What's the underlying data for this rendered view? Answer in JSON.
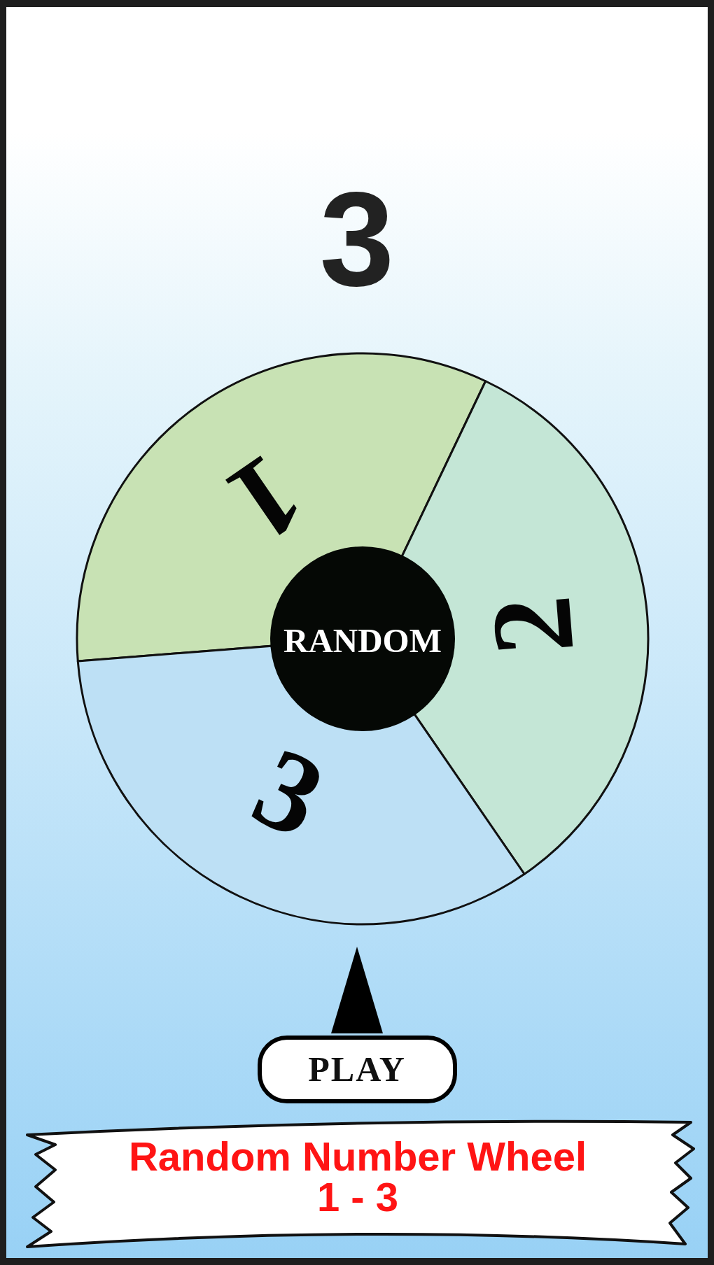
{
  "result": {
    "value": "3"
  },
  "wheel": {
    "segments": [
      {
        "label": "1",
        "color": "#c8e2b4"
      },
      {
        "label": "2",
        "color": "#c4e6d6"
      },
      {
        "label": "3",
        "color": "#bde0f5"
      }
    ],
    "hub_label": "RANDOM"
  },
  "play_button": {
    "label": "PLAY"
  },
  "banner": {
    "title": "Random Number Wheel",
    "range": "1 - 3"
  }
}
